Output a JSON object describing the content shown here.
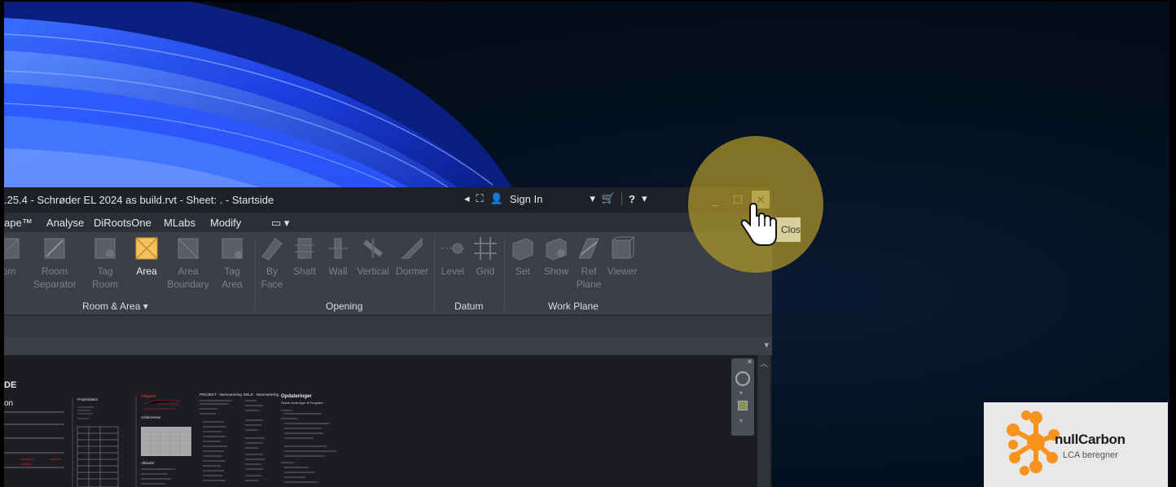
{
  "window": {
    "title": ".25.4 - Schrøder EL 2024 as build.rvt - Sheet: . - Startside",
    "sign_in": "Sign In",
    "close_tooltip": "Close"
  },
  "menu": [
    "ape™",
    "Analyse",
    "DiRootsOne",
    "MLabs",
    "Modify"
  ],
  "ribbon": {
    "groups": [
      {
        "label": "Room & Area ▾",
        "tools": [
          {
            "label": "om",
            "active": false
          },
          {
            "label": "Room\nSeparator",
            "active": false
          },
          {
            "label": "Tag\nRoom",
            "active": false
          },
          {
            "label": "Area",
            "active": true
          },
          {
            "label": "Area\nBoundary",
            "active": false
          },
          {
            "label": "Tag\nArea",
            "active": false
          }
        ]
      },
      {
        "label": "Opening",
        "tools": [
          {
            "label": "By\nFace",
            "active": false
          },
          {
            "label": "Shaft",
            "active": false
          },
          {
            "label": "Wall",
            "active": false
          },
          {
            "label": "Vertical",
            "active": false
          },
          {
            "label": "Dormer",
            "active": false
          }
        ]
      },
      {
        "label": "Datum",
        "tools": [
          {
            "label": "Level",
            "active": false
          },
          {
            "label": "Grid",
            "active": false
          }
        ]
      },
      {
        "label": "Work Plane",
        "tools": [
          {
            "label": "Set",
            "active": false
          },
          {
            "label": "Show",
            "active": false
          },
          {
            "label": "Ref\nPlane",
            "active": false
          },
          {
            "label": "Viewer",
            "active": false
          }
        ]
      }
    ]
  },
  "sheet": {
    "heading": "DE",
    "sub": "on",
    "col2_title": "Projektdaten",
    "col3_title": "Udgaver",
    "col3_sub": "Udskrivelser",
    "col3_sub2": "Afkluder",
    "col4_title": "PROJEKT - Nummerering",
    "col5_title": "DELE - Nummerering",
    "col6_title": "Opdateringer",
    "col6_sub": "Sidste ændringer til Template"
  },
  "logo": {
    "name": "nullCarbon",
    "tagline": "LCA beregner",
    "color": "#f7931e"
  },
  "colors": {
    "highlight": "#b09828",
    "active_tool": "#f5c060"
  }
}
